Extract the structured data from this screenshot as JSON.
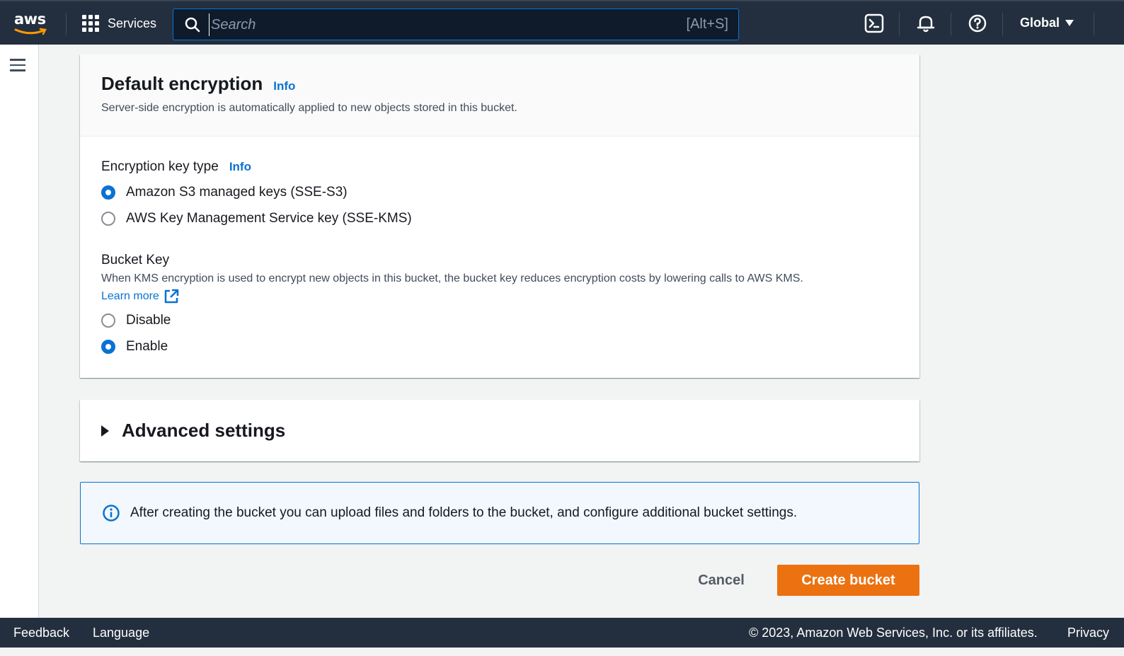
{
  "topnav": {
    "logo_text": "aws",
    "services_label": "Services",
    "search_placeholder": "Search",
    "search_shortcut": "[Alt+S]",
    "region_label": "Global"
  },
  "encryption": {
    "title": "Default encryption",
    "title_info": "Info",
    "description": "Server-side encryption is automatically applied to new objects stored in this bucket.",
    "key_type_label": "Encryption key type",
    "key_type_info": "Info",
    "key_type_options": [
      {
        "label": "Amazon S3 managed keys (SSE-S3)",
        "selected": true
      },
      {
        "label": "AWS Key Management Service key (SSE-KMS)",
        "selected": false
      }
    ],
    "bucket_key_label": "Bucket Key",
    "bucket_key_description": "When KMS encryption is used to encrypt new objects in this bucket, the bucket key reduces encryption costs by lowering calls to AWS KMS.",
    "learn_more": "Learn more",
    "bucket_key_options": [
      {
        "label": "Disable",
        "selected": false
      },
      {
        "label": "Enable",
        "selected": true
      }
    ]
  },
  "advanced": {
    "label": "Advanced settings"
  },
  "alert": {
    "text": "After creating the bucket you can upload files and folders to the bucket, and configure additional bucket settings."
  },
  "actions": {
    "cancel": "Cancel",
    "create": "Create bucket"
  },
  "footer": {
    "feedback": "Feedback",
    "language": "Language",
    "copyright": "© 2023, Amazon Web Services, Inc. or its affiliates.",
    "privacy": "Privacy"
  },
  "colors": {
    "nav_bg": "#232f3e",
    "link": "#0972d3",
    "primary_button": "#ec7211",
    "logo_smile": "#ff9900"
  }
}
